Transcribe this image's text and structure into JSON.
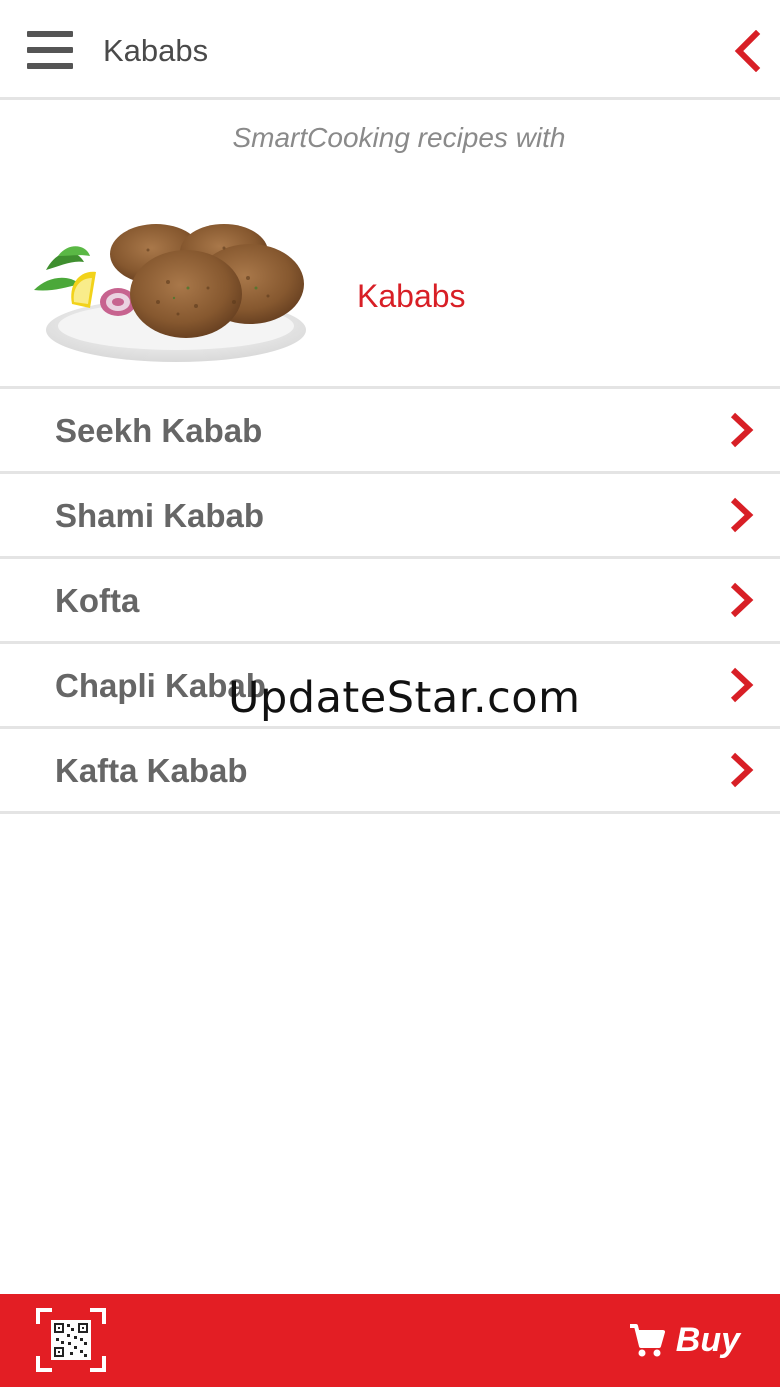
{
  "header": {
    "title": "Kababs",
    "menu_icon": "hamburger-menu-icon",
    "back_icon": "chevron-left-icon"
  },
  "banner": {
    "subtitle": "SmartCooking recipes with",
    "category": "Kababs",
    "image": "kabab-plate-image"
  },
  "recipes": [
    {
      "label": "Seekh Kabab"
    },
    {
      "label": "Shami Kabab"
    },
    {
      "label": "Kofta"
    },
    {
      "label": "Chapli Kabab"
    },
    {
      "label": "Kafta Kabab"
    }
  ],
  "watermark": "UpdateStar.com",
  "footer": {
    "scan_icon": "qr-scan-icon",
    "buy_label": "Buy",
    "cart_icon": "cart-icon"
  },
  "colors": {
    "accent": "#e31e24",
    "text": "#666666",
    "divider": "#e4e4e4"
  }
}
